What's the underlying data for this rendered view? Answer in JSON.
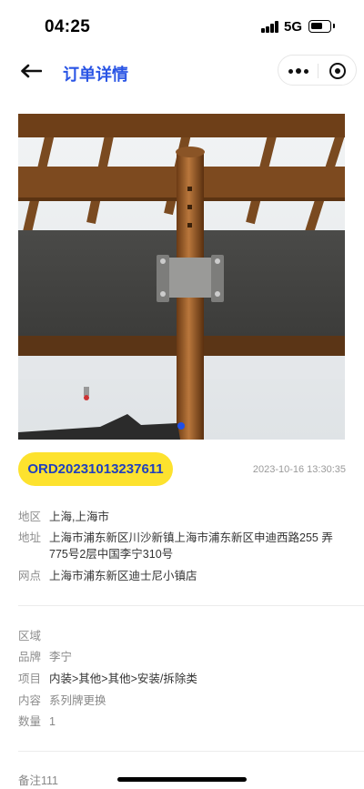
{
  "status_bar": {
    "time": "04:25",
    "network": "5G",
    "signal_icon": "signal-bars-icon",
    "battery_icon": "battery-icon"
  },
  "nav": {
    "title": "订单详情",
    "back_icon": "arrow-left-icon",
    "more_icon": "more-dots-icon",
    "close_icon": "target-circle-icon"
  },
  "photo": {
    "description_icon": "order-photo"
  },
  "order": {
    "number": "ORD20231013237611",
    "datetime": "2023-10-16 13:30:35"
  },
  "location": [
    {
      "label": "地区",
      "value": "上海,上海市"
    },
    {
      "label": "地址",
      "value": "上海市浦东新区川沙新镇上海市浦东新区申迪西路255 弄775号2层中国李宁310号"
    },
    {
      "label": "网点",
      "value": "上海市浦东新区迪士尼小镇店"
    }
  ],
  "details": [
    {
      "label": "区域",
      "value": ""
    },
    {
      "label": "品牌",
      "value": "李宁"
    },
    {
      "label": "项目",
      "value": "内装>其他>其他>安装/拆除类"
    },
    {
      "label": "内容",
      "value": "系列牌更换"
    },
    {
      "label": "数量",
      "value": "1"
    }
  ],
  "remark": {
    "text": "备注111"
  },
  "colors": {
    "accent": "#2a55e5",
    "badge": "#fde22e",
    "badge_text": "#1f3fbf"
  }
}
